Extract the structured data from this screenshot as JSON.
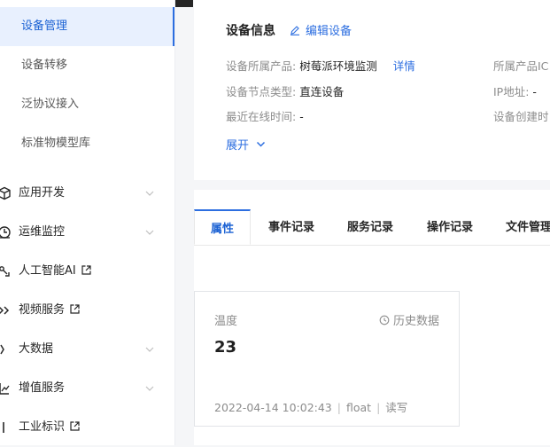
{
  "sidebar": {
    "sub_items": [
      {
        "label": "设备管理",
        "active": true
      },
      {
        "label": "设备转移",
        "active": false
      },
      {
        "label": "泛协议接入",
        "active": false
      },
      {
        "label": "标准物模型库",
        "active": false
      }
    ],
    "menu_items": [
      {
        "label": "应用开发",
        "icon": "cube-icon",
        "trailing": "chevron"
      },
      {
        "label": "运维监控",
        "icon": "monitor-icon",
        "trailing": "chevron"
      },
      {
        "label": "人工智能AI",
        "icon": "ai-icon",
        "trailing": "external"
      },
      {
        "label": "视频服务",
        "icon": "video-icon",
        "trailing": "external"
      },
      {
        "label": "大数据",
        "icon": "bigdata-icon",
        "trailing": "chevron"
      },
      {
        "label": "增值服务",
        "icon": "value-added-icon",
        "trailing": "chevron"
      },
      {
        "label": "工业标识",
        "icon": "industrial-id-icon",
        "trailing": "external"
      }
    ]
  },
  "device_info": {
    "title": "设备信息",
    "edit_label": "编辑设备",
    "product_key": "设备所属产品:",
    "product_value": "树莓派环境监测",
    "product_detail_link": "详情",
    "node_type_key": "设备节点类型:",
    "node_type_value": "直连设备",
    "last_online_key": "最近在线时间:",
    "last_online_value": "-",
    "right_col": {
      "product_id_key": "所属产品IC",
      "ip_key": "IP地址:",
      "ip_value": "-",
      "created_key": "设备创建时"
    },
    "expand_label": "展开"
  },
  "tabs": [
    {
      "label": "属性",
      "active": true
    },
    {
      "label": "事件记录",
      "active": false
    },
    {
      "label": "服务记录",
      "active": false
    },
    {
      "label": "操作记录",
      "active": false
    },
    {
      "label": "文件管理",
      "active": false
    }
  ],
  "property_card": {
    "name": "温度",
    "history_label": "历史数据",
    "value": "23",
    "timestamp": "2022-04-14 10:02:43",
    "data_type": "float",
    "access": "读写"
  },
  "colors": {
    "accent": "#2c6ee0",
    "active_bg": "#e8f0fe",
    "muted_text": "#8c8c8c"
  }
}
